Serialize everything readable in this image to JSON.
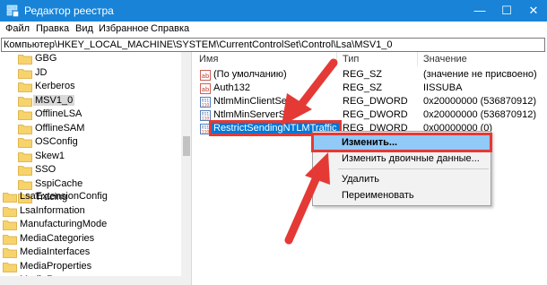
{
  "window": {
    "title": "Редактор реестра",
    "min": "—",
    "max": "☐",
    "close": "✕"
  },
  "menu": [
    "Файл",
    "Правка",
    "Вид",
    "Избранное",
    "Справка"
  ],
  "address": "Компьютер\\HKEY_LOCAL_MACHINE\\SYSTEM\\CurrentControlSet\\Control\\Lsa\\MSV1_0",
  "tree": {
    "children": [
      "GBG",
      "JD",
      "Kerberos",
      "MSV1_0",
      "OfflineLSA",
      "OfflineSAM",
      "OSConfig",
      "Skew1",
      "SSO",
      "SspiCache",
      "Tracing"
    ],
    "siblings": [
      "LsaExtensionConfig",
      "LsaInformation",
      "ManufacturingMode",
      "MediaCategories",
      "MediaInterfaces",
      "MediaProperties",
      "MediaResources"
    ],
    "selected": "MSV1_0"
  },
  "columns": {
    "name": "Имя",
    "type": "Тип",
    "value": "Значение"
  },
  "rows": [
    {
      "name": "(По умолчанию)",
      "type": "REG_SZ",
      "value": "(значение не присвоено)",
      "icon": "string-value-icon"
    },
    {
      "name": "Auth132",
      "type": "REG_SZ",
      "value": "IISSUBA",
      "icon": "string-value-icon"
    },
    {
      "name": "NtlmMinClientSec",
      "type": "REG_DWORD",
      "value": "0x20000000 (536870912)",
      "icon": "dword-value-icon"
    },
    {
      "name": "NtlmMinServerSec",
      "type": "REG_DWORD",
      "value": "0x20000000 (536870912)",
      "icon": "dword-value-icon"
    },
    {
      "name": "RestrictSendingNTLMTraffic",
      "type": "REG_DWORD",
      "value": "0x00000000 (0)",
      "icon": "dword-value-icon"
    }
  ],
  "context_menu": [
    "Изменить...",
    "Изменить двоичные данные...",
    "Удалить",
    "Переименовать"
  ],
  "colors": {
    "title_bar": "#1883d7",
    "selection": "#0078d7",
    "highlight": "#91c9f7",
    "annotation": "#e53935"
  }
}
